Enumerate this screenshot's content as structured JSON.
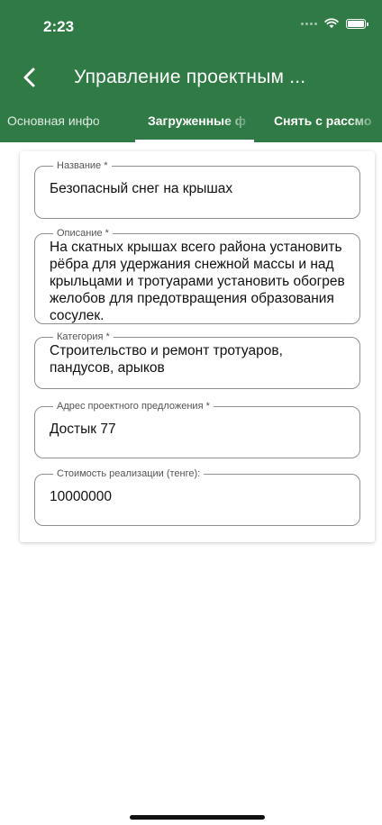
{
  "status_bar": {
    "time": "2:23"
  },
  "header": {
    "title": "Управление проектным ..."
  },
  "tabs": [
    {
      "label": "Основная инфо"
    },
    {
      "label": "Загруженные ф"
    },
    {
      "label": "Снять с рассмо"
    }
  ],
  "form": {
    "fields": [
      {
        "label": "Название *",
        "value": "Безопасный снег на крышах"
      },
      {
        "label": "Описание *",
        "value": "На скатных крышах всего района установить рёбра для удержания снежной массы и над крыльцами и тротуарами установить обогрев желобов для предотвращения образования сосулек."
      },
      {
        "label": "Категория *",
        "value": "Строительство и ремонт тротуаров, пандусов, арыков"
      },
      {
        "label": "Адрес проектного предложения *",
        "value": "Достык 77"
      },
      {
        "label": "Стоимость реализации (тенге):",
        "value": "10000000"
      }
    ]
  },
  "colors": {
    "header_bg": "#2f7a45",
    "text": "#111111",
    "border": "#8f8f8f"
  },
  "icons": {
    "back": "chevron-left-icon",
    "wifi": "wifi-icon",
    "battery": "battery-icon"
  }
}
